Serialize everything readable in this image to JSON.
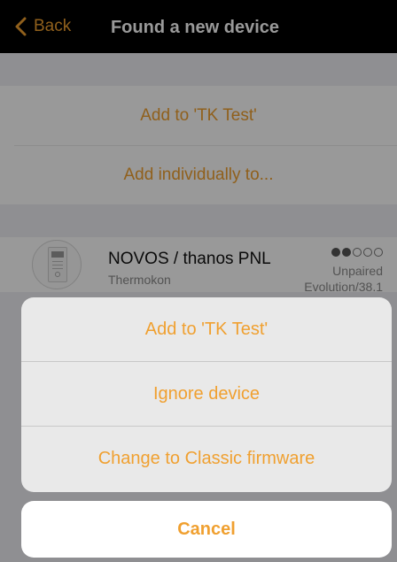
{
  "navbar": {
    "back_label": "Back",
    "title": "Found a new device"
  },
  "actions": {
    "add_to": "Add to 'TK Test'",
    "add_individually": "Add individually to..."
  },
  "device": {
    "name": "NOVOS / thanos PNL",
    "manufacturer": "Thermokon",
    "status": "Unpaired",
    "firmware": "Evolution/38.1",
    "signal_strength": 2,
    "signal_max": 5
  },
  "action_sheet": {
    "add_to": "Add to 'TK Test'",
    "ignore": "Ignore device",
    "change_firmware": "Change to Classic firmware",
    "cancel": "Cancel"
  },
  "colors": {
    "accent": "#f0a030",
    "navbar_bg": "#000000"
  },
  "icons": {
    "back": "chevron-left-icon",
    "signal": "signal-dots-icon"
  }
}
